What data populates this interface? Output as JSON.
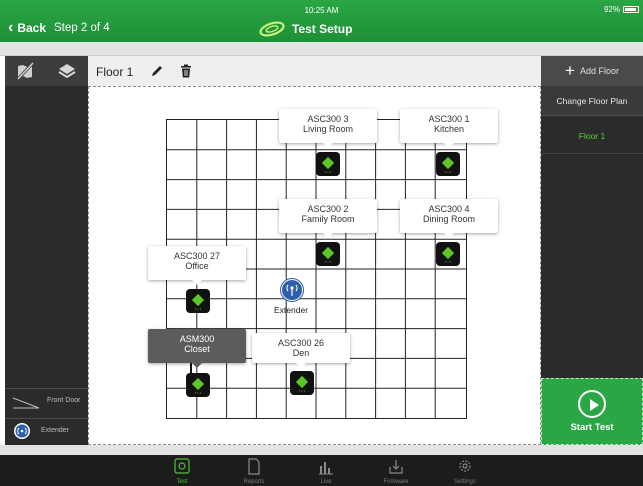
{
  "status_bar": {
    "time": "10:25 AM",
    "battery": "92%"
  },
  "header": {
    "back_label": "Back",
    "step": "Step 2 of 4",
    "title": "Test Setup"
  },
  "floor": {
    "name": "Floor 1"
  },
  "left_sidebar": {
    "items": [
      {
        "label": "Front Door",
        "icon": "door-icon"
      },
      {
        "label": "Extender",
        "icon": "extender-icon"
      }
    ]
  },
  "right_sidebar": {
    "add_floor": "Add Floor",
    "change_floor_plan": "Change Floor Plan",
    "floors": [
      "Floor 1"
    ],
    "start_test": "Start Test"
  },
  "devices": [
    {
      "model": "ASC300 3",
      "room": "Living Room"
    },
    {
      "model": "ASC300 1",
      "room": "Kitchen"
    },
    {
      "model": "ASC300 2",
      "room": "Family Room"
    },
    {
      "model": "ASC300 4",
      "room": "Dining Room"
    },
    {
      "model": "ASC300 27",
      "room": "Office"
    },
    {
      "model": "ASM300",
      "room": "Closet"
    },
    {
      "model": "ASC300 26",
      "room": "Den"
    }
  ],
  "extender_label": "Extender",
  "tabs": [
    "Test",
    "Reports",
    "Live",
    "Firmware",
    "Settings"
  ],
  "colors": {
    "brand_green": "#2aa645",
    "device_green": "#5bc624",
    "selected_floor": "#5cd03a"
  }
}
